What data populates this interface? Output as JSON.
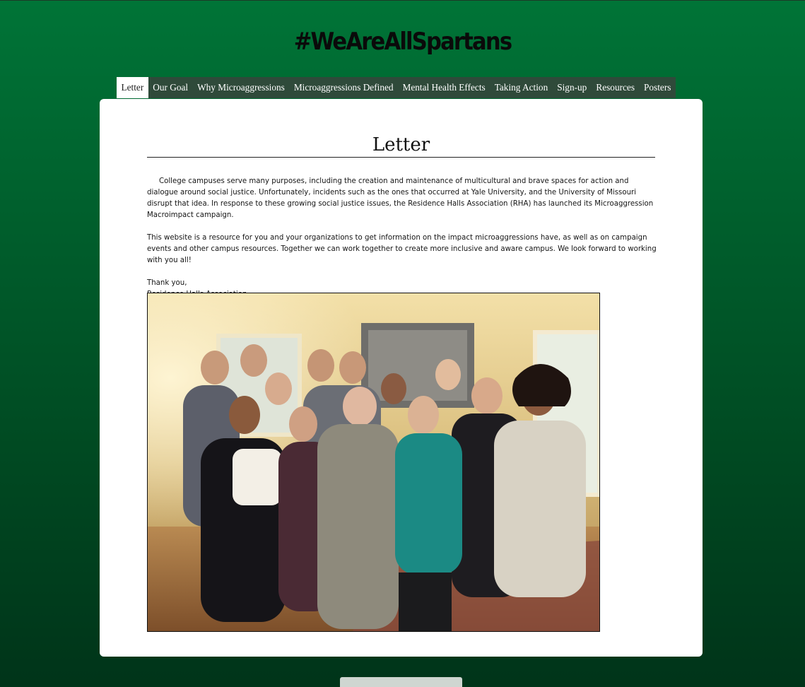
{
  "header": {
    "title": "#WeAreAllSpartans"
  },
  "nav": {
    "items": [
      {
        "label": "Letter",
        "active": true
      },
      {
        "label": "Our Goal"
      },
      {
        "label": "Why Microaggressions"
      },
      {
        "label": "Microaggressions Defined"
      },
      {
        "label": "Mental Health Effects"
      },
      {
        "label": "Taking Action"
      },
      {
        "label": "Sign-up"
      },
      {
        "label": "Resources"
      },
      {
        "label": "Posters"
      }
    ]
  },
  "main": {
    "heading": "Letter",
    "paragraphs": [
      "College campuses serve many purposes, including the creation and maintenance of multicultural and brave spaces for action and dialogue around social justice. Unfortunately, incidents such as the ones that occurred at Yale University, and the University of Missouri disrupt that idea. In response to these growing social justice issues, the Residence Halls Association (RHA) has launched its Microaggression Macroimpact campaign.",
      "This website is a resource for you and your organizations to get information on the impact microaggressions have, as well as on campaign events and other campus resources. Together we can work together to create more inclusive and aware campus. We look forward to working with you all!"
    ],
    "signoff": "Thank you,",
    "signature": "Residence Halls Association"
  },
  "colors": {
    "background_top": "#007437",
    "background_bottom": "#003419",
    "nav_background": "#2f4a3a",
    "nav_active_background": "#ffffff"
  }
}
